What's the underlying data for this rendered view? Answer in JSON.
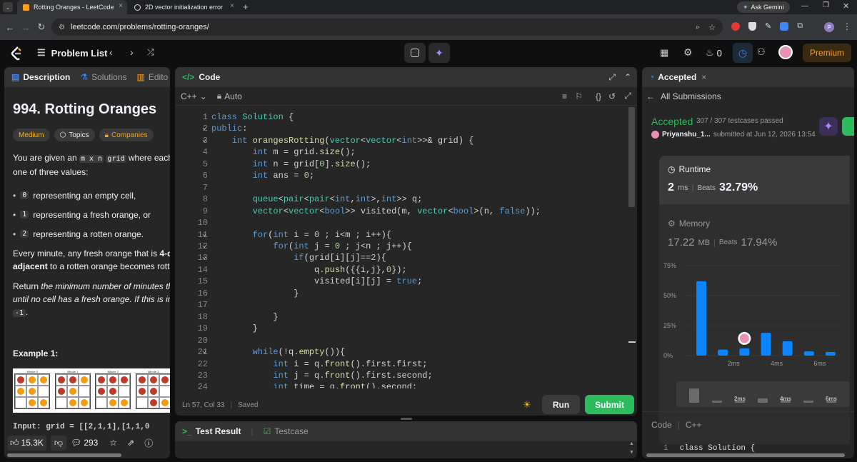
{
  "browser": {
    "tabs": [
      {
        "title": "Rotting Oranges - LeetCode"
      },
      {
        "title": "2D vector initialization error"
      }
    ],
    "url": "leetcode.com/problems/rotting-oranges/",
    "ask_gemini": "Ask Gemini",
    "profile_initial": "P"
  },
  "topbar": {
    "problem_list": "Problem List",
    "streak": "0",
    "premium": "Premium"
  },
  "left": {
    "tabs": [
      "Description",
      "Solutions",
      "Edito"
    ],
    "title": "994. Rotting Oranges",
    "tags": [
      "Medium",
      "Topics",
      "Companies"
    ],
    "p1a": "You are given an ",
    "p1code": "m x n",
    "p1b": " ",
    "p1code2": "grid",
    "p1c": " where each c",
    "p1d": "one of three values:",
    "bullets": [
      {
        "code": "0",
        "text": " representing an empty cell,"
      },
      {
        "code": "1",
        "text": " representing a fresh orange, or"
      },
      {
        "code": "2",
        "text": " representing a rotten orange."
      }
    ],
    "p2a": "Every minute, any fresh orange that is ",
    "p2b": "4-dir",
    "p2c": "adjacent",
    "p2d": " to a rotten orange becomes rotter",
    "p3a": "Return ",
    "p3b": "the minimum number of minutes tha",
    "p3c": "until no cell has a fresh orange. If this is impo",
    "p3code": "-1",
    "example": "Example 1:",
    "minute_labels": [
      "Minute 0",
      "Minute 1",
      "Minute 2",
      "Minute 3"
    ],
    "input_line": "Input: grid = [[2,1,1],[1,1,0",
    "likes": "15.3K",
    "comments": "293"
  },
  "editor": {
    "title": "Code",
    "language": "C++",
    "mode": "Auto",
    "status": "Ln 57, Col 33",
    "saved": "Saved",
    "run": "Run",
    "submit": "Submit",
    "lines": [
      [
        [
          "kw",
          "class"
        ],
        [
          "tx2",
          " "
        ],
        [
          "ty",
          "Solution"
        ],
        [
          "tx2",
          " {"
        ]
      ],
      [
        [
          "kw",
          "public"
        ],
        [
          "tx2",
          ":"
        ]
      ],
      [
        [
          "tx2",
          "    "
        ],
        [
          "kw",
          "int"
        ],
        [
          "tx2",
          " "
        ],
        [
          "fn",
          "orangesRotting"
        ],
        [
          "tx2",
          "("
        ],
        [
          "ty",
          "vector"
        ],
        [
          "tx2",
          "<"
        ],
        [
          "ty",
          "vector"
        ],
        [
          "tx2",
          "<"
        ],
        [
          "kw",
          "int"
        ],
        [
          "tx2",
          ">>& grid) {"
        ]
      ],
      [
        [
          "tx2",
          "        "
        ],
        [
          "kw",
          "int"
        ],
        [
          "tx2",
          " m = grid."
        ],
        [
          "fn",
          "size"
        ],
        [
          "tx2",
          "();"
        ]
      ],
      [
        [
          "tx2",
          "        "
        ],
        [
          "kw",
          "int"
        ],
        [
          "tx2",
          " n = grid["
        ],
        [
          "nm",
          "0"
        ],
        [
          "tx2",
          "]."
        ],
        [
          "fn",
          "size"
        ],
        [
          "tx2",
          "();"
        ]
      ],
      [
        [
          "tx2",
          "        "
        ],
        [
          "kw",
          "int"
        ],
        [
          "tx2",
          " ans = "
        ],
        [
          "nm",
          "0"
        ],
        [
          "tx2",
          ";"
        ]
      ],
      [
        [
          "tx2",
          ""
        ]
      ],
      [
        [
          "tx2",
          "        "
        ],
        [
          "ty",
          "queue"
        ],
        [
          "tx2",
          "<"
        ],
        [
          "ty",
          "pair"
        ],
        [
          "tx2",
          "<"
        ],
        [
          "ty",
          "pair"
        ],
        [
          "tx2",
          "<"
        ],
        [
          "kw",
          "int"
        ],
        [
          "tx2",
          ","
        ],
        [
          "kw",
          "int"
        ],
        [
          "tx2",
          ">,"
        ],
        [
          "kw",
          "int"
        ],
        [
          "tx2",
          ">> q;"
        ]
      ],
      [
        [
          "tx2",
          "        "
        ],
        [
          "ty",
          "vector"
        ],
        [
          "tx2",
          "<"
        ],
        [
          "ty",
          "vector"
        ],
        [
          "tx2",
          "<"
        ],
        [
          "kw",
          "bool"
        ],
        [
          "tx2",
          ">> visited(m, "
        ],
        [
          "ty",
          "vector"
        ],
        [
          "tx2",
          "<"
        ],
        [
          "kw",
          "bool"
        ],
        [
          "tx2",
          ">(n, "
        ],
        [
          "lit",
          "false"
        ],
        [
          "tx2",
          "));"
        ]
      ],
      [
        [
          "tx2",
          ""
        ]
      ],
      [
        [
          "tx2",
          "        "
        ],
        [
          "kw",
          "for"
        ],
        [
          "tx2",
          "("
        ],
        [
          "kw",
          "int"
        ],
        [
          "tx2",
          " i = "
        ],
        [
          "nm",
          "0"
        ],
        [
          "tx2",
          " ; i<m ; i++){"
        ]
      ],
      [
        [
          "tx2",
          "            "
        ],
        [
          "kw",
          "for"
        ],
        [
          "tx2",
          "("
        ],
        [
          "kw",
          "int"
        ],
        [
          "tx2",
          " j = "
        ],
        [
          "nm",
          "0"
        ],
        [
          "tx2",
          " ; j<n ; j++){"
        ]
      ],
      [
        [
          "tx2",
          "                "
        ],
        [
          "kw",
          "if"
        ],
        [
          "tx2",
          "(grid[i][j]=="
        ],
        [
          "nm",
          "2"
        ],
        [
          "tx2",
          "){"
        ]
      ],
      [
        [
          "tx2",
          "                    q."
        ],
        [
          "fn",
          "push"
        ],
        [
          "tx2",
          "({{i,j},"
        ],
        [
          "nm",
          "0"
        ],
        [
          "tx2",
          "});"
        ]
      ],
      [
        [
          "tx2",
          "                    visited[i][j] = "
        ],
        [
          "lit",
          "true"
        ],
        [
          "tx2",
          ";"
        ]
      ],
      [
        [
          "tx2",
          "                }"
        ]
      ],
      [
        [
          "tx2",
          ""
        ]
      ],
      [
        [
          "tx2",
          "            }"
        ]
      ],
      [
        [
          "tx2",
          "        }"
        ]
      ],
      [
        [
          "tx2",
          ""
        ]
      ],
      [
        [
          "tx2",
          "        "
        ],
        [
          "kw",
          "while"
        ],
        [
          "tx2",
          "(!q."
        ],
        [
          "fn",
          "empty"
        ],
        [
          "tx2",
          "()){"
        ]
      ],
      [
        [
          "tx2",
          "            "
        ],
        [
          "kw",
          "int"
        ],
        [
          "tx2",
          " i = q."
        ],
        [
          "fn",
          "front"
        ],
        [
          "tx2",
          "().first.first;"
        ]
      ],
      [
        [
          "tx2",
          "            "
        ],
        [
          "kw",
          "int"
        ],
        [
          "tx2",
          " j = q."
        ],
        [
          "fn",
          "front"
        ],
        [
          "tx2",
          "().first.second;"
        ]
      ],
      [
        [
          "tx2",
          "            "
        ],
        [
          "kw",
          "int"
        ],
        [
          "tx2",
          " time = q."
        ],
        [
          "fn",
          "front"
        ],
        [
          "tx2",
          "().second;"
        ]
      ]
    ],
    "line_numbers": [
      "1",
      "2",
      "3",
      "4",
      "5",
      "6",
      "7",
      "8",
      "9",
      "10",
      "11",
      "12",
      "13",
      "14",
      "15",
      "16",
      "17",
      "18",
      "19",
      "20",
      "21",
      "22",
      "23",
      "24"
    ]
  },
  "bottom": {
    "test_result": "Test Result",
    "testcase": "Testcase"
  },
  "right": {
    "tab": "Accepted",
    "all_submissions": "All Submissions",
    "status": "Accepted",
    "passed": "307 / 307 testcases passed",
    "user": "Priyanshu_1...",
    "submitted": "submitted at Jun 12, 2026 13:54",
    "runtime_label": "Runtime",
    "runtime_value": "2",
    "runtime_unit": "ms",
    "beats": "Beats",
    "runtime_beats": "32.79%",
    "memory_label": "Memory",
    "memory_value": "17.22",
    "memory_unit": "MB",
    "memory_beats": "17.94%",
    "code_label": "Code",
    "code_lang": "C++",
    "code_line_no": "1",
    "code_line": "class Solution {"
  },
  "chart_data": {
    "type": "bar",
    "title": "",
    "y_ticks": [
      "75%",
      "50%",
      "25%",
      "0%"
    ],
    "ylim": [
      0,
      0.75
    ],
    "x_ticks": [
      "2ms",
      "4ms",
      "6ms"
    ],
    "values": [
      0.62,
      0.05,
      0.06,
      0.19,
      0.12,
      0.035,
      0.03
    ],
    "highlight_index": 2,
    "minimap_ticks": [
      "2ms",
      "4ms",
      "6ms"
    ]
  },
  "colors": {
    "accent": "#2cbb5d",
    "blue": "#0a84ff",
    "medium": "#ffb800",
    "premium": "#ffa116"
  }
}
